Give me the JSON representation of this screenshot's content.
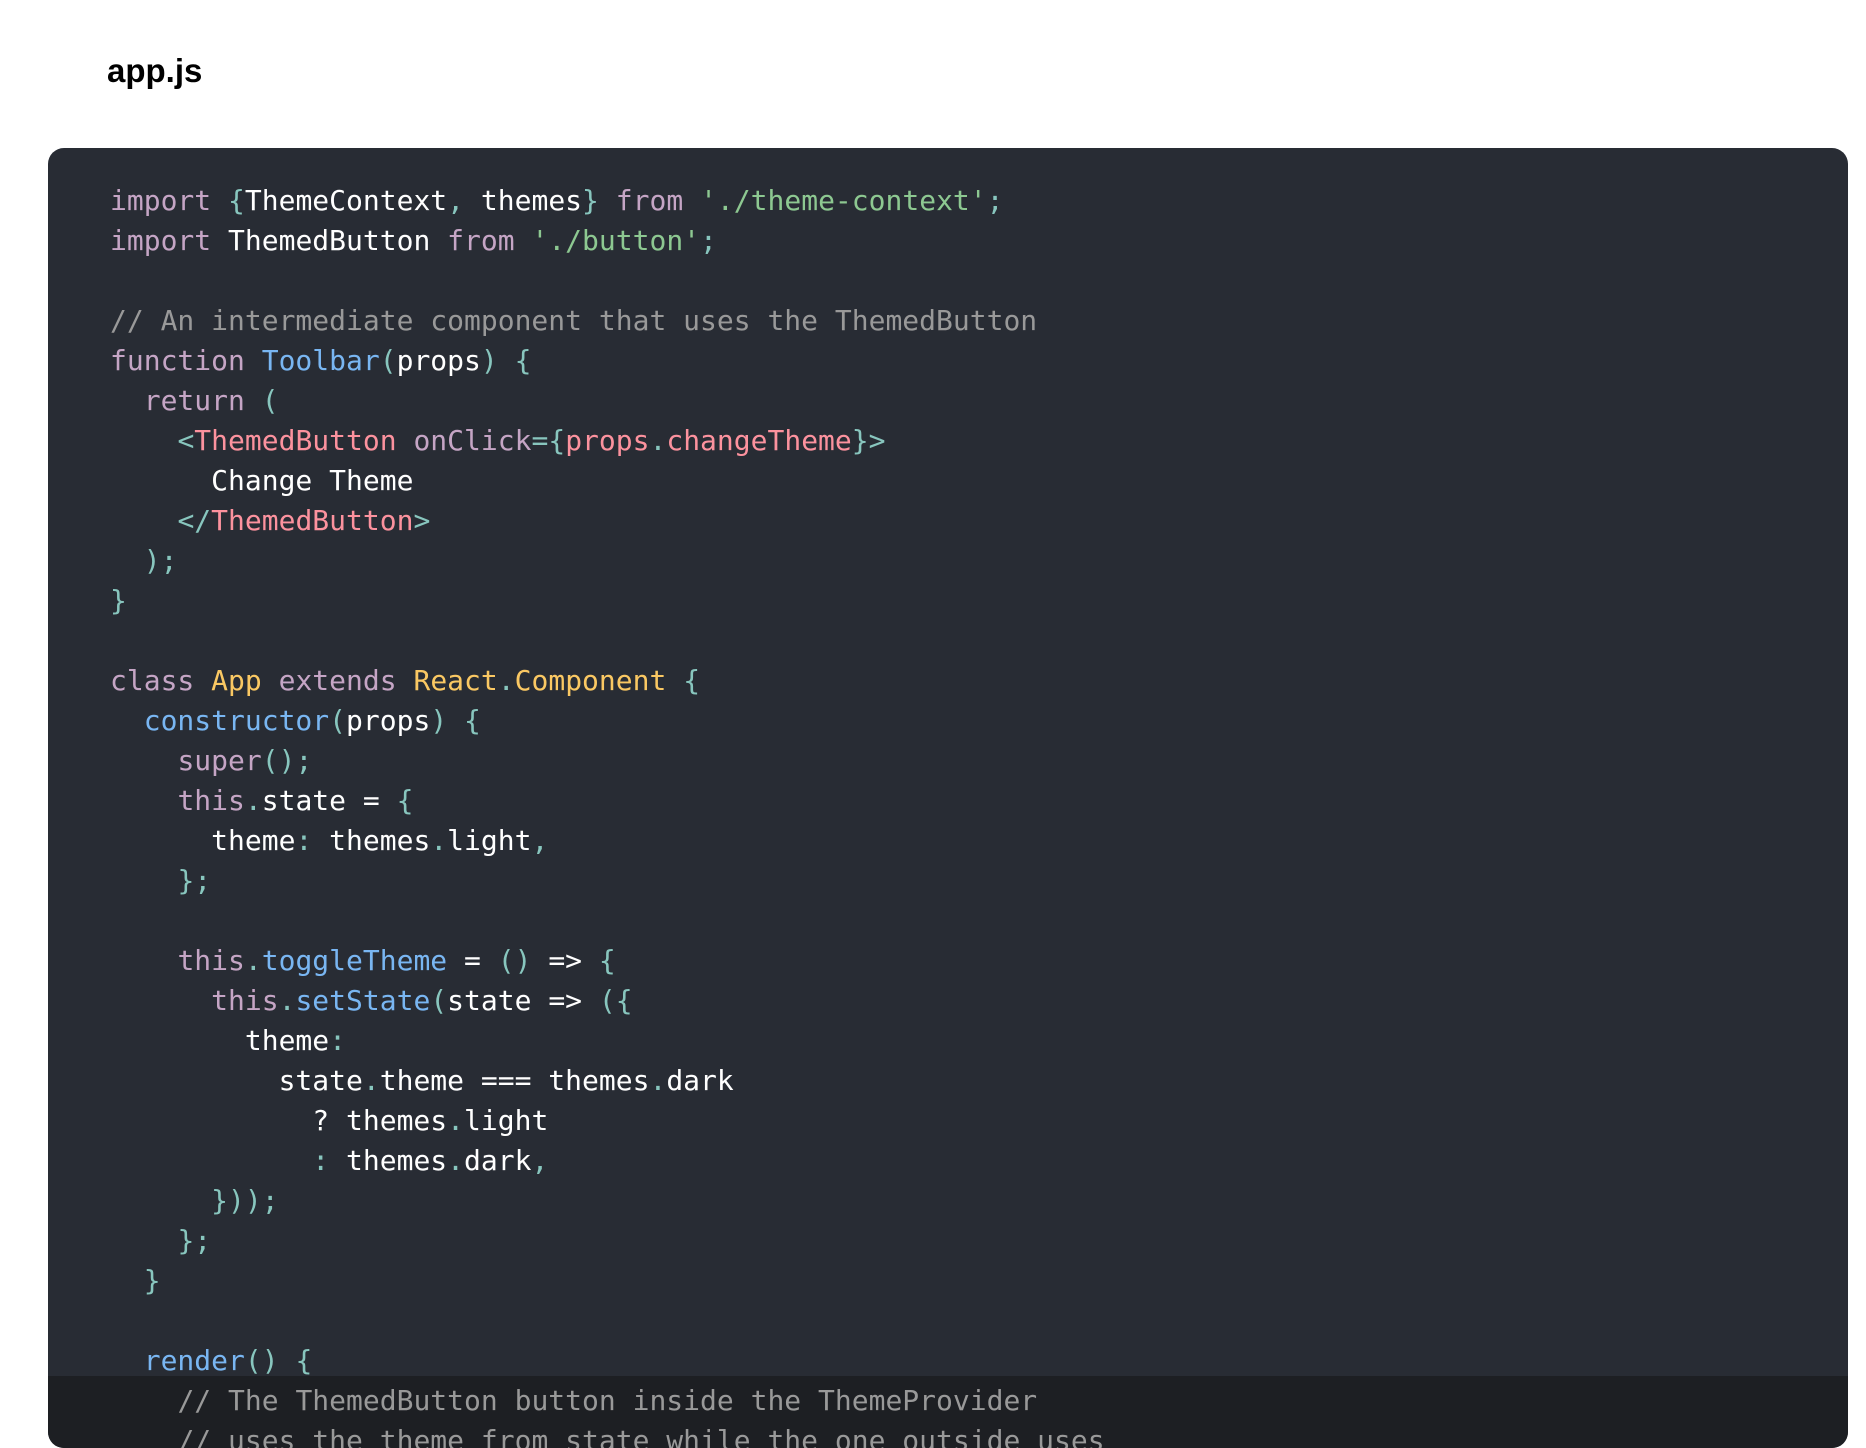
{
  "file": {
    "title": "app.js"
  },
  "code": {
    "lines": [
      [
        [
          "kw",
          "import"
        ],
        [
          "pl",
          " "
        ],
        [
          "pun",
          "{"
        ],
        [
          "pl",
          "ThemeContext"
        ],
        [
          "pun",
          ","
        ],
        [
          "pl",
          " themes"
        ],
        [
          "pun",
          "}"
        ],
        [
          "pl",
          " "
        ],
        [
          "kw",
          "from"
        ],
        [
          "pl",
          " "
        ],
        [
          "str",
          "'./theme-context'"
        ],
        [
          "pun",
          ";"
        ]
      ],
      [
        [
          "kw",
          "import"
        ],
        [
          "pl",
          " ThemedButton "
        ],
        [
          "kw",
          "from"
        ],
        [
          "pl",
          " "
        ],
        [
          "str",
          "'./button'"
        ],
        [
          "pun",
          ";"
        ]
      ],
      [],
      [
        [
          "com",
          "// An intermediate component that uses the ThemedButton"
        ]
      ],
      [
        [
          "kw",
          "function"
        ],
        [
          "pl",
          " "
        ],
        [
          "fn",
          "Toolbar"
        ],
        [
          "pun",
          "("
        ],
        [
          "pl",
          "props"
        ],
        [
          "pun",
          ")"
        ],
        [
          "pl",
          " "
        ],
        [
          "pun",
          "{"
        ]
      ],
      [
        [
          "pl",
          "  "
        ],
        [
          "kw",
          "return"
        ],
        [
          "pl",
          " "
        ],
        [
          "pun",
          "("
        ]
      ],
      [
        [
          "pl",
          "    "
        ],
        [
          "pun",
          "<"
        ],
        [
          "tag",
          "ThemedButton"
        ],
        [
          "pl",
          " "
        ],
        [
          "attr",
          "onClick"
        ],
        [
          "pun",
          "="
        ],
        [
          "pun",
          "{"
        ],
        [
          "tag",
          "props"
        ],
        [
          "pun",
          "."
        ],
        [
          "tag",
          "changeTheme"
        ],
        [
          "pun",
          "}"
        ],
        [
          "pun",
          ">"
        ]
      ],
      [
        [
          "pl",
          "      Change Theme"
        ]
      ],
      [
        [
          "pl",
          "    "
        ],
        [
          "pun",
          "</"
        ],
        [
          "tag",
          "ThemedButton"
        ],
        [
          "pun",
          ">"
        ]
      ],
      [
        [
          "pl",
          "  "
        ],
        [
          "pun",
          ");"
        ]
      ],
      [
        [
          "pun",
          "}"
        ]
      ],
      [],
      [
        [
          "kw",
          "class"
        ],
        [
          "pl",
          " "
        ],
        [
          "cls",
          "App"
        ],
        [
          "pl",
          " "
        ],
        [
          "kw",
          "extends"
        ],
        [
          "pl",
          " "
        ],
        [
          "cls",
          "React"
        ],
        [
          "pun",
          "."
        ],
        [
          "cls",
          "Component"
        ],
        [
          "pl",
          " "
        ],
        [
          "pun",
          "{"
        ]
      ],
      [
        [
          "pl",
          "  "
        ],
        [
          "fn",
          "constructor"
        ],
        [
          "pun",
          "("
        ],
        [
          "pl",
          "props"
        ],
        [
          "pun",
          ")"
        ],
        [
          "pl",
          " "
        ],
        [
          "pun",
          "{"
        ]
      ],
      [
        [
          "pl",
          "    "
        ],
        [
          "kw",
          "super"
        ],
        [
          "pun",
          "();"
        ]
      ],
      [
        [
          "pl",
          "    "
        ],
        [
          "kw",
          "this"
        ],
        [
          "pun",
          "."
        ],
        [
          "pl",
          "state = "
        ],
        [
          "pun",
          "{"
        ]
      ],
      [
        [
          "pl",
          "      theme"
        ],
        [
          "pun",
          ":"
        ],
        [
          "pl",
          " themes"
        ],
        [
          "pun",
          "."
        ],
        [
          "pl",
          "light"
        ],
        [
          "pun",
          ","
        ]
      ],
      [
        [
          "pl",
          "    "
        ],
        [
          "pun",
          "};"
        ]
      ],
      [],
      [
        [
          "pl",
          "    "
        ],
        [
          "kw",
          "this"
        ],
        [
          "pun",
          "."
        ],
        [
          "fn",
          "toggleTheme"
        ],
        [
          "pl",
          " = "
        ],
        [
          "pun",
          "()"
        ],
        [
          "pl",
          " => "
        ],
        [
          "pun",
          "{"
        ]
      ],
      [
        [
          "pl",
          "      "
        ],
        [
          "kw",
          "this"
        ],
        [
          "pun",
          "."
        ],
        [
          "fn",
          "setState"
        ],
        [
          "pun",
          "("
        ],
        [
          "pl",
          "state => "
        ],
        [
          "pun",
          "({"
        ]
      ],
      [
        [
          "pl",
          "        theme"
        ],
        [
          "pun",
          ":"
        ]
      ],
      [
        [
          "pl",
          "          state"
        ],
        [
          "pun",
          "."
        ],
        [
          "pl",
          "theme === themes"
        ],
        [
          "pun",
          "."
        ],
        [
          "pl",
          "dark"
        ]
      ],
      [
        [
          "pl",
          "            ? themes"
        ],
        [
          "pun",
          "."
        ],
        [
          "pl",
          "light"
        ]
      ],
      [
        [
          "pl",
          "            "
        ],
        [
          "pun",
          ":"
        ],
        [
          "pl",
          " themes"
        ],
        [
          "pun",
          "."
        ],
        [
          "pl",
          "dark"
        ],
        [
          "pun",
          ","
        ]
      ],
      [
        [
          "pl",
          "      "
        ],
        [
          "pun",
          "}));"
        ]
      ],
      [
        [
          "pl",
          "    "
        ],
        [
          "pun",
          "};"
        ]
      ],
      [
        [
          "pl",
          "  "
        ],
        [
          "pun",
          "}"
        ]
      ],
      [],
      [
        [
          "pl",
          "  "
        ],
        [
          "fn",
          "render"
        ],
        [
          "pun",
          "()"
        ],
        [
          "pl",
          " "
        ],
        [
          "pun",
          "{"
        ]
      ],
      [
        [
          "pl",
          "    "
        ],
        [
          "com",
          "// The ThemedButton button inside the ThemeProvider"
        ]
      ],
      [
        [
          "pl",
          "    "
        ],
        [
          "com",
          "// uses the theme from state while the one outside uses"
        ]
      ]
    ]
  }
}
